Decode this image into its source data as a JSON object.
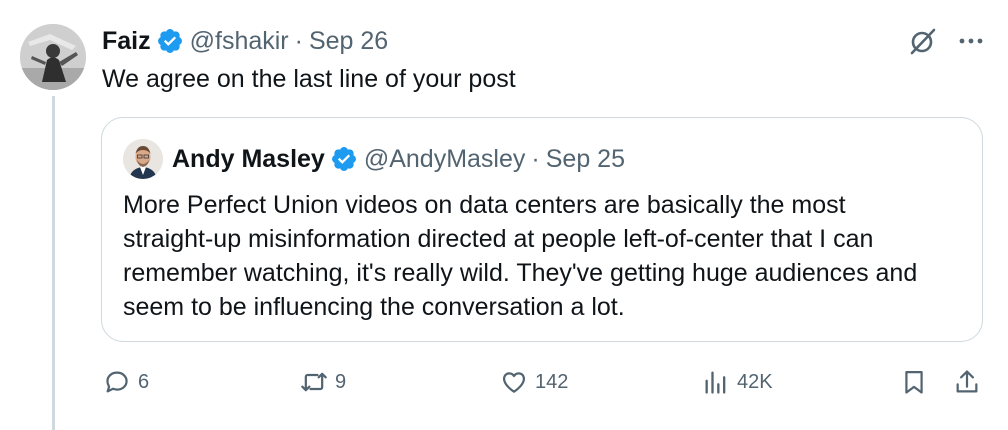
{
  "tweet": {
    "author": {
      "name": "Faiz",
      "handle": "@fshakir",
      "date": "Sep 26"
    },
    "text": "We agree on the last line of your post",
    "icons": {
      "verified": "verified-badge-icon",
      "grok": "grok-icon",
      "more": "more-icon"
    }
  },
  "quote": {
    "author": {
      "name": "Andy Masley",
      "handle": "@AndyMasley",
      "date": "Sep 25"
    },
    "lines": [
      "More Perfect Union videos on data centers are basically the most",
      "straight-up misinformation directed at people left-of-center that I can",
      "remember watching, it's really wild. They've getting huge audiences and",
      "seem to be influencing the conversation a lot."
    ]
  },
  "actions": {
    "reply_count": "6",
    "retweet_count": "9",
    "like_count": "142",
    "views_count": "42K",
    "icons": [
      "reply-icon",
      "retweet-icon",
      "like-icon",
      "views-icon",
      "bookmark-icon",
      "share-icon"
    ]
  },
  "colors": {
    "text": "#0f1419",
    "secondary": "#536471",
    "border": "#cfd9de",
    "verified": "#1d9bf0"
  },
  "separator": "·"
}
